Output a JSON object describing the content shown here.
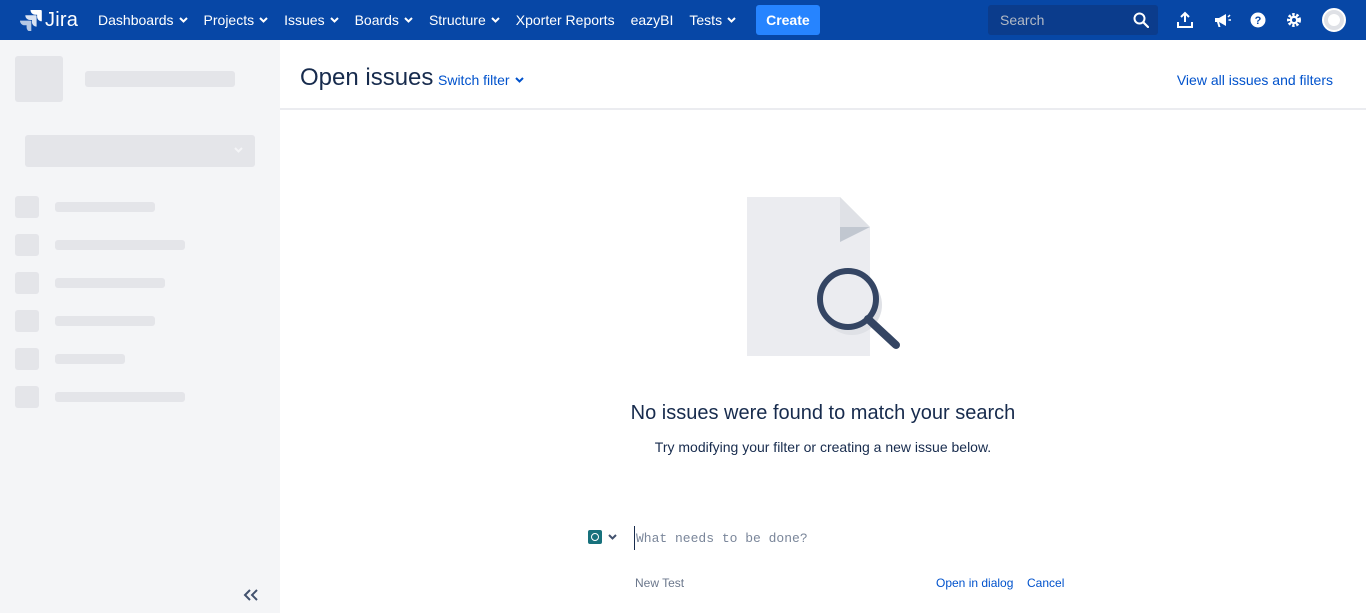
{
  "brand": {
    "name": "Jira"
  },
  "nav": {
    "items": [
      {
        "label": "Dashboards",
        "dropdown": true
      },
      {
        "label": "Projects",
        "dropdown": true
      },
      {
        "label": "Issues",
        "dropdown": true
      },
      {
        "label": "Boards",
        "dropdown": true
      },
      {
        "label": "Structure",
        "dropdown": true
      },
      {
        "label": "Xporter Reports",
        "dropdown": false
      },
      {
        "label": "eazyBI",
        "dropdown": false
      },
      {
        "label": "Tests",
        "dropdown": true
      }
    ],
    "create_label": "Create",
    "search_placeholder": "Search",
    "icons": [
      "upload-icon",
      "megaphone-icon",
      "help-icon",
      "gear-icon",
      "avatar"
    ]
  },
  "header": {
    "title": "Open issues",
    "switch_filter": "Switch filter",
    "view_all": "View all issues and filters"
  },
  "empty_state": {
    "title": "No issues were found to match your search",
    "description": "Try modifying your filter or creating a new issue below."
  },
  "inline_create": {
    "placeholder": "What needs to be done?",
    "issue_type": "New Test",
    "open_in_dialog": "Open in dialog",
    "cancel": "Cancel"
  },
  "colors": {
    "nav_bg": "#0747a6",
    "create_bg": "#2684ff",
    "link": "#0052cc",
    "sidebar_bg": "#f4f5f7",
    "test_type": "#17717c"
  }
}
